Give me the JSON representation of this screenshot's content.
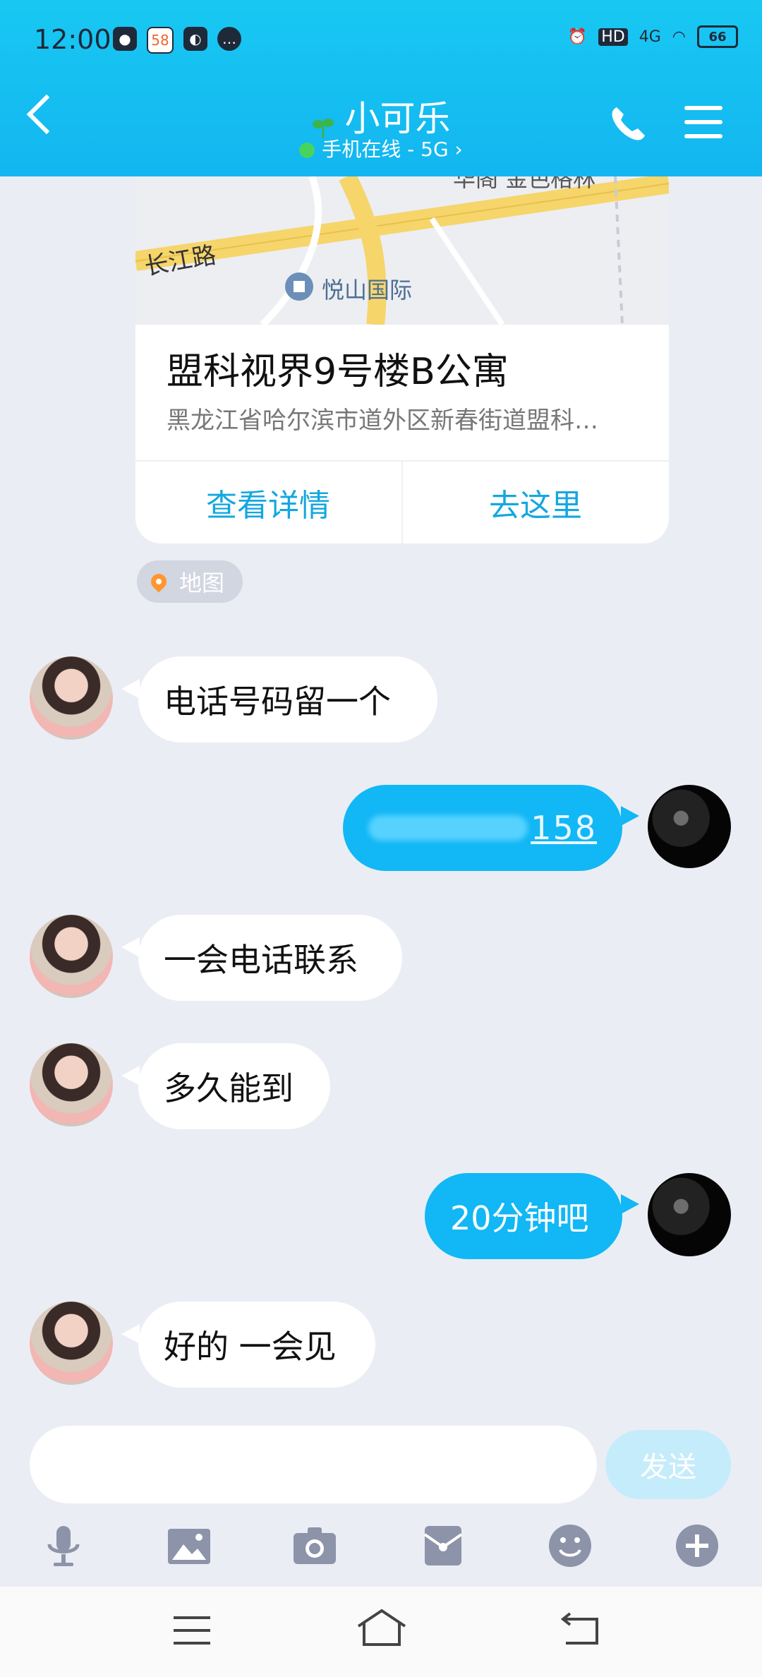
{
  "status_bar": {
    "time": "12:00",
    "app_badge": "58",
    "network": "4G",
    "hd": "HD",
    "battery": "66"
  },
  "header": {
    "contact_name": "小可乐",
    "subtitle": "手机在线 - 5G ›"
  },
  "location_card": {
    "map_labels": {
      "road": "长江路",
      "poi": "悦山国际",
      "top": "华阁   金色格林"
    },
    "title": "盟科视界9号楼B公寓",
    "address": "黑龙江省哈尔滨市道外区新春街道盟科…",
    "buttons": {
      "details": "查看详情",
      "go_here": "去这里"
    }
  },
  "map_tag": {
    "label": "地图"
  },
  "messages": [
    {
      "side": "in",
      "text": "电话号码留一个"
    },
    {
      "side": "out",
      "text": "158"
    },
    {
      "side": "in",
      "text": "一会电话联系"
    },
    {
      "side": "in",
      "text": "多久能到"
    },
    {
      "side": "out",
      "text": "20分钟吧"
    },
    {
      "side": "in",
      "text": "好的 一会见"
    }
  ],
  "composer": {
    "send_label": "发送",
    "placeholder": ""
  },
  "colors": {
    "header": "#12b6f0",
    "bubble_out": "#12b7f5",
    "accent_text": "#14a7e0",
    "background": "#ebedf5"
  }
}
